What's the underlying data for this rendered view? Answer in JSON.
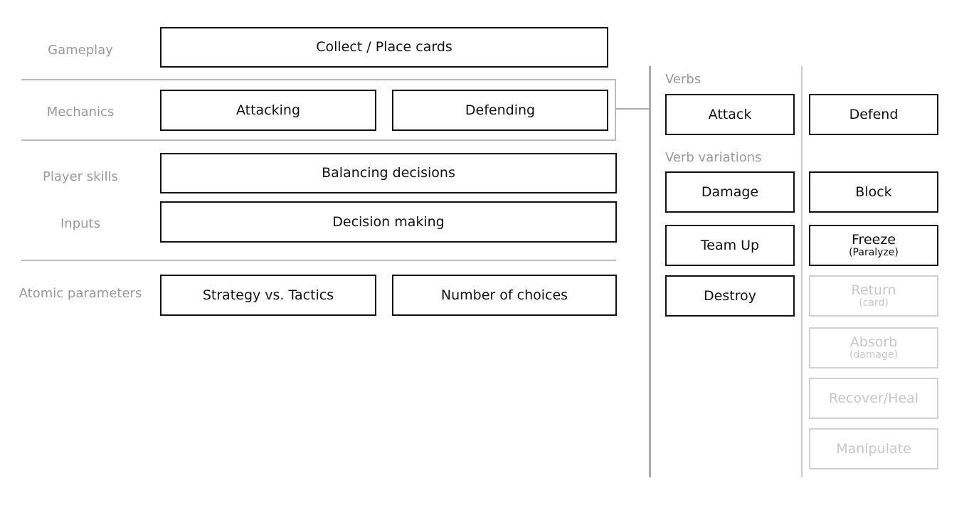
{
  "left": {
    "labels": {
      "gameplay": "Gameplay",
      "mechanics": "Mechanics",
      "player_skills": "Player skills",
      "inputs": "Inputs",
      "atomic": "Atomic parameters"
    },
    "boxes": {
      "collect": "Collect / Place cards",
      "attacking": "Attacking",
      "defending": "Defending",
      "balancing": "Balancing decisions",
      "decision": "Decision making",
      "strategy": "Strategy vs. Tactics",
      "choices": "Number of choices"
    }
  },
  "right": {
    "verbs_label": "Verbs",
    "variations_label": "Verb variations",
    "col1": [
      {
        "label": "Attack"
      },
      {
        "label": "Damage"
      },
      {
        "label": "Team Up"
      },
      {
        "label": "Destroy"
      }
    ],
    "col2": [
      {
        "label": "Defend"
      },
      {
        "label": "Block"
      },
      {
        "label": "Freeze",
        "sub": "(Paralyze)"
      },
      {
        "label": "Return",
        "sub": "(card)",
        "faded": true
      },
      {
        "label": "Absorb",
        "sub": "(damage)",
        "faded": true
      },
      {
        "label": "Recover/Heal",
        "faded": true
      },
      {
        "label": "Manipulate",
        "faded": true
      }
    ]
  }
}
